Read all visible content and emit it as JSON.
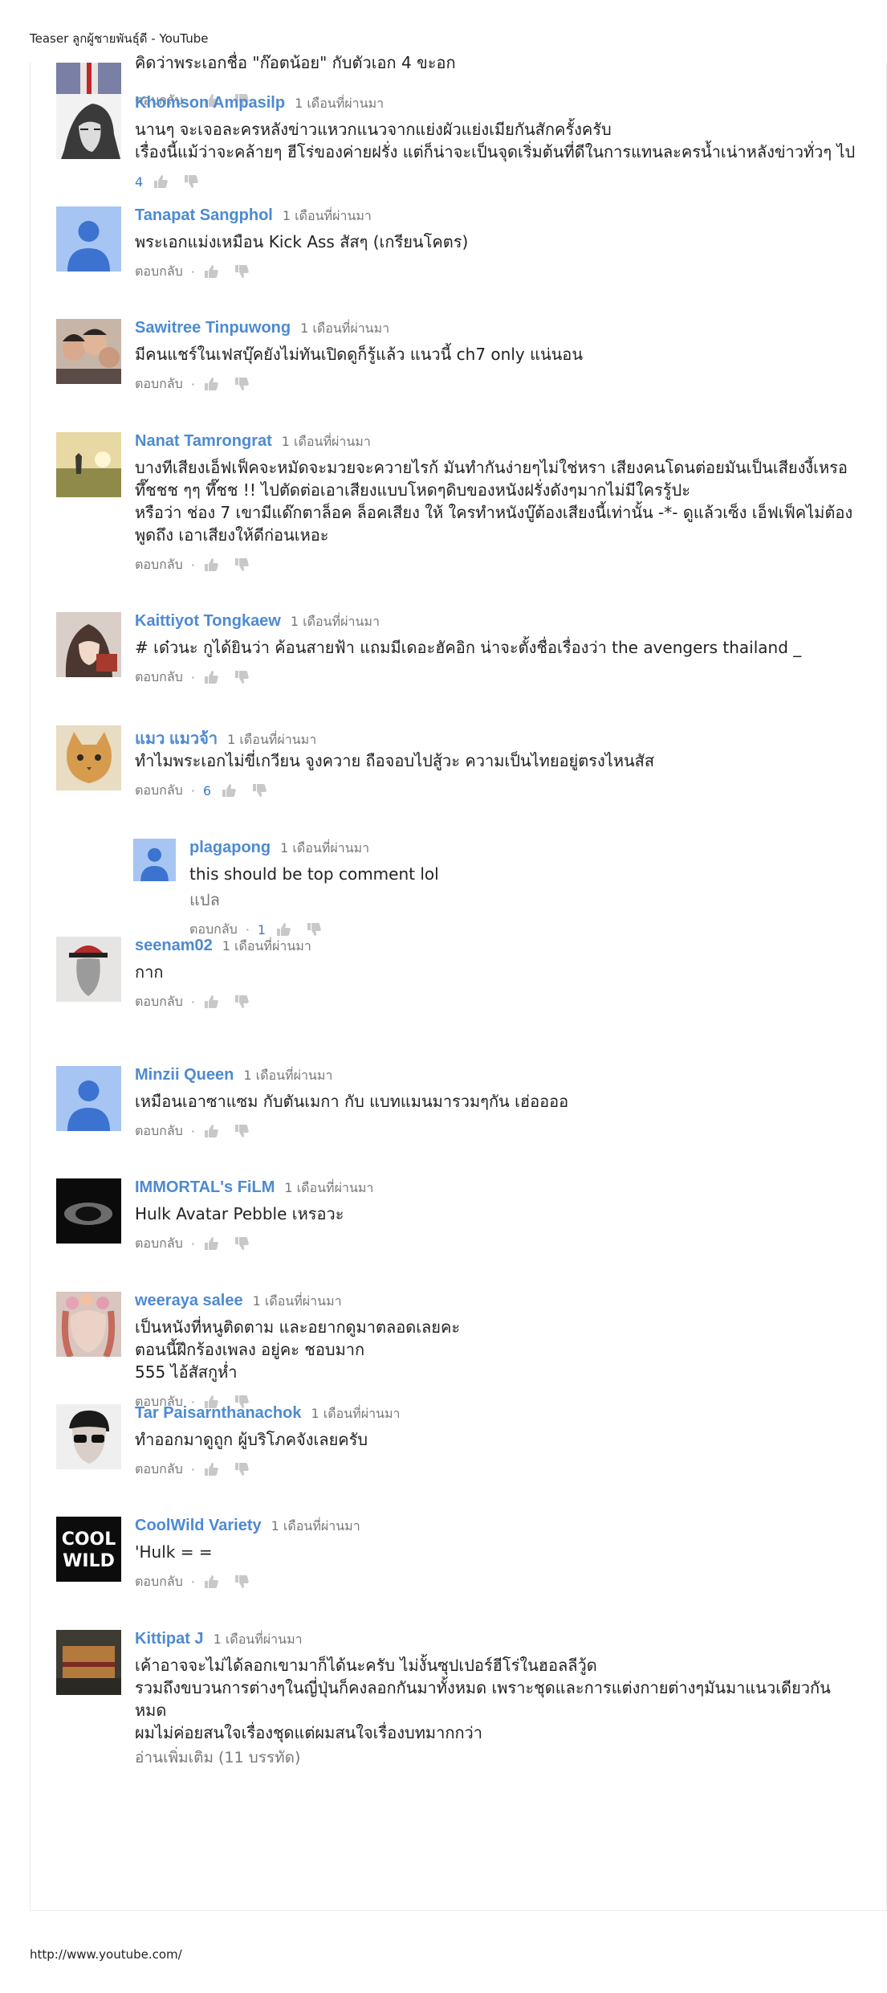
{
  "print_header": "Teaser ลูกผู้ชายพันธุ์ดี - YouTube",
  "print_footer": "http://www.youtube.com/",
  "partial_top": {
    "text": "คิดว่าพระเอกชื่อ \"ก๊อตน้อย\" กับตัวเอก 4 ขะอก",
    "reply_label": "ตอบกลับ"
  },
  "comments": [
    {
      "author": "Khomson Ampasilp",
      "time": "1 เดือนที่ผ่านมา",
      "text": "นานๆ จะเจอละครหลังข่าวแหวกแนวจากแย่งผัวแย่งเมียกันสักครั้งครับ\nเรื่องนี้แม้ว่าจะคล้ายๆ ฮีโร่ของค่ายฝรั่ง แต่ก็น่าจะเป็นจุดเริ่มต้นที่ดีในการแทนละครน้ำเน่าหลังข่าวทั่วๆ ไป",
      "likes": "4",
      "reply_label": "",
      "avatar": "manga",
      "reply": false
    },
    {
      "author": "Tanapat Sangphol",
      "time": "1 เดือนที่ผ่านมา",
      "text": "พระเอกแม่งเหมือน Kick Ass สัสๆ (เกรียนโคตร)",
      "likes": "",
      "reply_label": "ตอบกลับ",
      "avatar": "default",
      "reply": false
    },
    {
      "author": "Sawitree Tinpuwong",
      "time": "1 เดือนที่ผ่านมา",
      "text": "มีคนแชร์ในเฟสบุ๊คยังไม่ทันเปิดดูก็รู้แล้ว แนวนี้ ch7 only แน่นอน",
      "likes": "",
      "reply_label": "ตอบกลับ",
      "avatar": "group",
      "reply": false
    },
    {
      "author": "Nanat Tamrongrat",
      "time": "1 เดือนที่ผ่านมา",
      "text": "บางทีเสียงเอ็ฟเฟ็คจะหมัดจะมวยจะควายไรก้ มันทำกันง่ายๆไม่ใช่หรา เสียงคนโดนต่อยมันเป็นเสียงงี้เหรอ ทึ๊ชชช ๆๆ ทึ๊ชช !!  ไปตัดต่อเอาเสียงแบบโหดๆดิบของหนังฝรั่งดังๆมากไม่มีใครรู้ปะ\nหรือว่า ช่อง 7 เขามีแด๊กตาล็อค ล็อคเสียง ให้ ใครทำหนังบู๊ต้องเสียงนี้เท่านั้น  -*- ดูแล้วเซ็ง เอ็ฟเฟ็คไม่ต้องพูดถึง เอาเสียงให้ดีก่อนเหอะ",
      "likes": "",
      "reply_label": "ตอบกลับ",
      "avatar": "sunset",
      "reply": false
    },
    {
      "author": "Kaittiyot Tongkaew",
      "time": "1 เดือนที่ผ่านมา",
      "text": "# เด๋วนะ กูได้ยินว่า ค้อนสายฟ้า แถมมีเดอะฮัคอิก น่าจะตั้งชื่อเรื่องว่า the avengers thailand _",
      "likes": "",
      "reply_label": "ตอบกลับ",
      "avatar": "anime",
      "reply": false
    },
    {
      "author": "แมว แมวจ้า",
      "time": "1 เดือนที่ผ่านมา",
      "text": "ทำไมพระเอกไม่ขี่เกวียน จูงควาย ถือจอบไปสู้วะ ความเป็นไทยอยู่ตรงไหนสัส",
      "likes": "6",
      "reply_label": "ตอบกลับ",
      "avatar": "cat",
      "reply": false
    },
    {
      "author": "plagapong",
      "time": "1 เดือนที่ผ่านมา",
      "text": "this should be top comment lol",
      "subtext": "แปล",
      "likes": "1",
      "reply_label": "ตอบกลับ",
      "avatar": "default",
      "reply": true
    },
    {
      "author": "seenam02",
      "time": "1 เดือนที่ผ่านมา",
      "text": "กาก",
      "likes": "",
      "reply_label": "ตอบกลับ",
      "avatar": "hat",
      "reply": false
    },
    {
      "author": "Minzii Queen",
      "time": "1 เดือนที่ผ่านมา",
      "text": "เหมือนเอาซาแซม กับตันเมกา กับ แบทแมนมารวมๆกัน เฮ่ออออ",
      "likes": "",
      "reply_label": "ตอบกลับ",
      "avatar": "default",
      "reply": false
    },
    {
      "author": "IMMORTAL's FiLM",
      "time": "1 เดือนที่ผ่านมา",
      "text": "Hulk Avatar Pebble เหรอวะ",
      "likes": "",
      "reply_label": "ตอบกลับ",
      "avatar": "dark",
      "reply": false
    },
    {
      "author": "weeraya salee",
      "time": "1 เดือนที่ผ่านมา",
      "text": "เป็นหนังที่หนูติดตาม และอยากดูมาตลอดเลยคะ\nตอนนี้ฝึกร้องเพลง อยู่คะ ชอบมาก\n555 ไอ้สัสกูห่ำ",
      "likes": "",
      "reply_label": "ตอบกลับ",
      "avatar": "flower",
      "reply": false
    },
    {
      "author": "Tar Paisarnthanachok",
      "time": "1 เดือนที่ผ่านมา",
      "text": "ทำออกมาดูถูก ผู้บริโภคจังเลยครับ",
      "likes": "",
      "reply_label": "ตอบกลับ",
      "avatar": "sunglasses",
      "reply": false
    },
    {
      "author": "CoolWild Variety",
      "time": "1 เดือนที่ผ่านมา",
      "text": "'Hulk = =",
      "likes": "",
      "reply_label": "ตอบกลับ",
      "avatar": "coolwild",
      "reply": false
    },
    {
      "author": "Kittipat J",
      "time": "1 เดือนที่ผ่านมา",
      "text": "เค้าอาจจะไม่ได้ลอกเขามาก็ได้นะครับ  ไม่งั้นซุปเปอร์ฮีโร่ในฮอลลีวู้ด\nรวมถึงขบวนการต่างๆในญี่ปุ่นก็คงลอกกันมาทั้งหมด เพราะชุดและการแต่งกายต่างๆมันมาแนวเดียวกันหมด\nผมไม่ค่อยสนใจเรื่องชุดแต่ผมสนใจเรื่องบทมากกว่า",
      "readmore": "อ่านเพิ่มเติม (11 บรรทัด)",
      "likes": "",
      "reply_label": "",
      "avatar": "temple",
      "reply": false
    }
  ]
}
